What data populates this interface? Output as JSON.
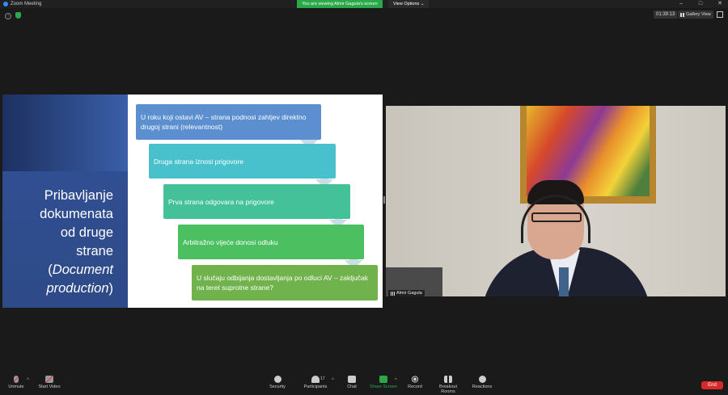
{
  "window": {
    "title": "Zoom Meeting",
    "minimize": "–",
    "maximize": "□",
    "close": "✕"
  },
  "share_banner": {
    "text": "You are viewing Almir Gagula's screen",
    "view_options": "View Options ⌄"
  },
  "meeting_info": {
    "timer": "01:39:13",
    "gallery_view": "Gallery View"
  },
  "slide": {
    "title_line1": "Pribavljanje",
    "title_line2": "dokumenata",
    "title_line3": "od druge",
    "title_line4": "strane",
    "title_open": "(",
    "title_italic1": "Document",
    "title_italic2": "production",
    "title_close": ")",
    "steps": [
      {
        "text": "U roku koji ostavi AV – strana podnosi zahtjev direktno drugoj strani (relevantnost)",
        "color": "#5b8fd0"
      },
      {
        "text": "Druga strana iznosi prigovore",
        "color": "#49c1cc"
      },
      {
        "text": "Prva strana odgovara na prigovore",
        "color": "#44c199"
      },
      {
        "text": "Arbitražno vijeće donosi odluku",
        "color": "#4cc060"
      },
      {
        "text": "U slučaju odbijanja dostavljanja po odluci AV – zaključak na teret suprotne strane?",
        "color": "#70b24b"
      }
    ]
  },
  "participant": {
    "name": "Almir Gagula"
  },
  "toolbar": {
    "unmute": "Unmute",
    "start_video": "Start Video",
    "security": "Security",
    "participants": "Participants",
    "participants_count": "17",
    "chat": "Chat",
    "share_screen": "Share Screen",
    "record": "Record",
    "breakout_rooms": "Breakout Rooms",
    "reactions": "Reactions",
    "end": "End"
  }
}
